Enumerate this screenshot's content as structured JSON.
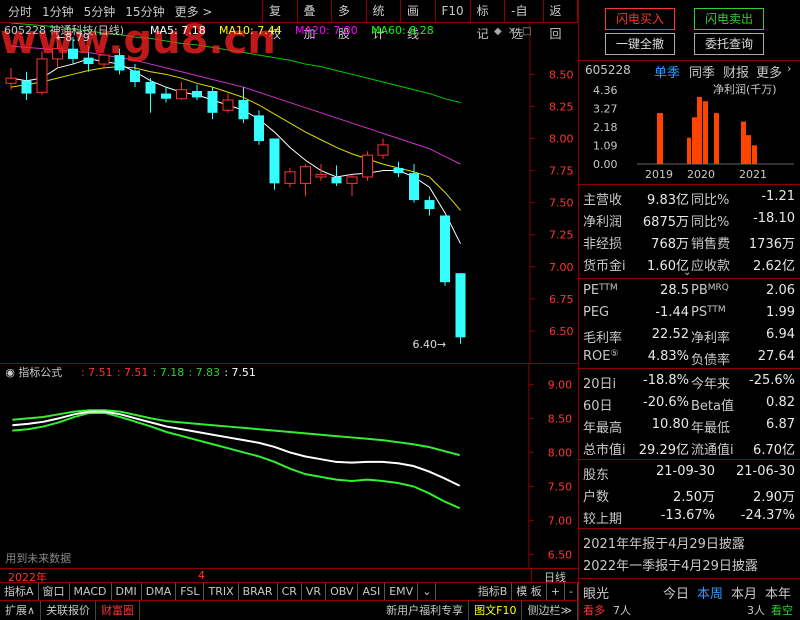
{
  "toolbar": {
    "periods": [
      "分时",
      "1分钟",
      "5分钟",
      "15分钟",
      "更多 >"
    ],
    "actions": [
      "复权",
      "叠加",
      "多股",
      "统计",
      "画线",
      "F10",
      "标记",
      "-自选",
      "返回"
    ]
  },
  "main_chart": {
    "stock_title": "605228 神通科技(日线)",
    "ma": [
      {
        "label": "MA5: 7.18",
        "color": "#ffffff"
      },
      {
        "label": "MA10: 7.44",
        "color": "#ffff00"
      },
      {
        "label": "MA20: 7.80",
        "color": "#ff00ff"
      },
      {
        "label": "MA60: 8.28",
        "color": "#00ff00"
      }
    ],
    "high_label": "8.79",
    "low_label": "6.40",
    "y_ticks": [
      "8.50",
      "8.25",
      "8.00",
      "7.75",
      "7.50",
      "7.25",
      "7.00",
      "6.75",
      "6.50"
    ],
    "watermark": "www.gu8.cn",
    "icons": [
      "diamond-icon",
      "close-icon",
      "square-icon"
    ]
  },
  "chart_data": {
    "type": "candlestick",
    "ylim": [
      6.25,
      8.9
    ],
    "candles": [
      {
        "o": 8.43,
        "h": 8.55,
        "l": 8.38,
        "c": 8.47
      },
      {
        "o": 8.45,
        "h": 8.52,
        "l": 8.3,
        "c": 8.35
      },
      {
        "o": 8.36,
        "h": 8.68,
        "l": 8.34,
        "c": 8.62
      },
      {
        "o": 8.62,
        "h": 8.75,
        "l": 8.55,
        "c": 8.7
      },
      {
        "o": 8.7,
        "h": 8.79,
        "l": 8.58,
        "c": 8.62
      },
      {
        "o": 8.63,
        "h": 8.72,
        "l": 8.52,
        "c": 8.58
      },
      {
        "o": 8.58,
        "h": 8.66,
        "l": 8.55,
        "c": 8.65
      },
      {
        "o": 8.65,
        "h": 8.7,
        "l": 8.5,
        "c": 8.53
      },
      {
        "o": 8.53,
        "h": 8.58,
        "l": 8.4,
        "c": 8.44
      },
      {
        "o": 8.44,
        "h": 8.47,
        "l": 8.2,
        "c": 8.35
      },
      {
        "o": 8.35,
        "h": 8.4,
        "l": 8.28,
        "c": 8.31
      },
      {
        "o": 8.31,
        "h": 8.44,
        "l": 8.3,
        "c": 8.38
      },
      {
        "o": 8.37,
        "h": 8.42,
        "l": 8.3,
        "c": 8.32
      },
      {
        "o": 8.37,
        "h": 8.4,
        "l": 8.15,
        "c": 8.2
      },
      {
        "o": 8.22,
        "h": 8.35,
        "l": 8.2,
        "c": 8.3
      },
      {
        "o": 8.3,
        "h": 8.4,
        "l": 8.12,
        "c": 8.15
      },
      {
        "o": 8.18,
        "h": 8.22,
        "l": 7.95,
        "c": 7.98
      },
      {
        "o": 8.0,
        "h": 8.0,
        "l": 7.6,
        "c": 7.65
      },
      {
        "o": 7.65,
        "h": 7.77,
        "l": 7.62,
        "c": 7.74
      },
      {
        "o": 7.65,
        "h": 7.8,
        "l": 7.55,
        "c": 7.78
      },
      {
        "o": 7.7,
        "h": 7.8,
        "l": 7.67,
        "c": 7.72
      },
      {
        "o": 7.7,
        "h": 7.79,
        "l": 7.63,
        "c": 7.65
      },
      {
        "o": 7.65,
        "h": 7.72,
        "l": 7.55,
        "c": 7.7
      },
      {
        "o": 7.7,
        "h": 7.9,
        "l": 7.67,
        "c": 7.87
      },
      {
        "o": 7.87,
        "h": 8.0,
        "l": 7.84,
        "c": 7.95
      },
      {
        "o": 7.77,
        "h": 7.82,
        "l": 7.7,
        "c": 7.73
      },
      {
        "o": 7.73,
        "h": 7.8,
        "l": 7.5,
        "c": 7.52
      },
      {
        "o": 7.52,
        "h": 7.55,
        "l": 7.4,
        "c": 7.45
      },
      {
        "o": 7.4,
        "h": 7.4,
        "l": 6.85,
        "c": 6.88
      },
      {
        "o": 6.95,
        "h": 6.95,
        "l": 6.4,
        "c": 6.45
      }
    ],
    "ma5": [
      8.47,
      8.45,
      8.47,
      8.55,
      8.58,
      8.62,
      8.6,
      8.58,
      8.52,
      8.45,
      8.4,
      8.36,
      8.34,
      8.3,
      8.26,
      8.22,
      8.15,
      8.05,
      7.93,
      7.83,
      7.75,
      7.7,
      7.72,
      7.73,
      7.75,
      7.75,
      7.7,
      7.62,
      7.42,
      7.18
    ],
    "ma10": [
      8.4,
      8.42,
      8.44,
      8.47,
      8.5,
      8.53,
      8.55,
      8.56,
      8.55,
      8.52,
      8.5,
      8.47,
      8.43,
      8.4,
      8.36,
      8.32,
      8.26,
      8.19,
      8.12,
      8.05,
      7.99,
      7.93,
      7.88,
      7.84,
      7.8,
      7.77,
      7.74,
      7.7,
      7.58,
      7.44
    ],
    "ma20": [
      8.72,
      8.71,
      8.7,
      8.69,
      8.68,
      8.67,
      8.65,
      8.63,
      8.61,
      8.58,
      8.55,
      8.52,
      8.49,
      8.46,
      8.43,
      8.4,
      8.36,
      8.32,
      8.28,
      8.24,
      8.2,
      8.16,
      8.12,
      8.08,
      8.04,
      8.0,
      7.96,
      7.92,
      7.86,
      7.8
    ],
    "ma60": [
      8.9,
      8.89,
      8.88,
      8.87,
      8.85,
      8.84,
      8.82,
      8.81,
      8.79,
      8.78,
      8.76,
      8.74,
      8.73,
      8.71,
      8.69,
      8.67,
      8.65,
      8.63,
      8.61,
      8.58,
      8.56,
      8.53,
      8.5,
      8.47,
      8.44,
      8.41,
      8.38,
      8.35,
      8.31,
      8.28
    ]
  },
  "indicator": {
    "label": "指标公式",
    "values": [
      {
        "text": ": 7.51",
        "color": "#ff3333"
      },
      {
        "text": ": 7.51",
        "color": "#ff3333"
      },
      {
        "text": ": 7.18",
        "color": "#33cc33"
      },
      {
        "text": ": 7.83",
        "color": "#33cc33"
      },
      {
        "text": ": 7.51",
        "color": "#ffffff"
      }
    ],
    "y_ticks": [
      "9.00",
      "8.50",
      "8.00",
      "7.50",
      "7.00",
      "6.50"
    ],
    "footnote": "用到未来数据",
    "ylim": [
      6.3,
      9.3
    ],
    "upper": [
      8.48,
      8.5,
      8.52,
      8.56,
      8.6,
      8.62,
      8.62,
      8.6,
      8.55,
      8.5,
      8.46,
      8.44,
      8.42,
      8.4,
      8.38,
      8.36,
      8.34,
      8.32,
      8.3,
      8.28,
      8.26,
      8.24,
      8.22,
      8.2,
      8.18,
      8.15,
      8.12,
      8.08,
      8.02,
      7.96
    ],
    "mid": [
      8.4,
      8.42,
      8.45,
      8.5,
      8.56,
      8.6,
      8.6,
      8.56,
      8.5,
      8.44,
      8.38,
      8.34,
      8.3,
      8.26,
      8.22,
      8.18,
      8.14,
      8.08,
      8.0,
      7.94,
      7.9,
      7.86,
      7.85,
      7.86,
      7.86,
      7.84,
      7.8,
      7.72,
      7.62,
      7.51
    ],
    "lower": [
      8.32,
      8.34,
      8.38,
      8.44,
      8.52,
      8.58,
      8.58,
      8.52,
      8.45,
      8.38,
      8.3,
      8.24,
      8.18,
      8.12,
      8.06,
      8.0,
      7.94,
      7.86,
      7.76,
      7.68,
      7.64,
      7.6,
      7.58,
      7.6,
      7.58,
      7.55,
      7.5,
      7.4,
      7.28,
      7.18
    ]
  },
  "time_axis": {
    "year": "2022年",
    "month": "4",
    "period": "日线"
  },
  "indicator_tabs": [
    "指标A",
    "窗口",
    "MACD",
    "DMI",
    "DMA",
    "FSL",
    "TRIX",
    "BRAR",
    "CR",
    "VR",
    "OBV",
    "ASI",
    "EMV",
    "⌄",
    "指标B",
    "模 板",
    "+",
    "-"
  ],
  "bottom_bar": {
    "items": [
      "扩展∧",
      "关联报价",
      "财富圈"
    ],
    "promo": "新用户福利专享",
    "f10": "图文F10",
    "sidebar": "侧边栏≫"
  },
  "trade": {
    "buy": "闪电买入",
    "sell": "闪电卖出",
    "all": "一键全撤",
    "query": "委托查询"
  },
  "fin": {
    "code": "605228",
    "tabs": [
      "单季",
      "同季",
      "财报",
      "更多"
    ],
    "more_arrow": "›",
    "bar_title": "净利润(千万)",
    "bar_y": [
      "4.36",
      "3.27",
      "2.18",
      "1.09",
      "0.00"
    ],
    "bar_years": [
      "2019",
      "2020",
      "2021"
    ],
    "bar_values": [
      3.0,
      1.55,
      2.75,
      3.95,
      3.7,
      3.0,
      2.5,
      1.7,
      1.1
    ]
  },
  "rows1": [
    {
      "l1": "主营收",
      "v1": "9.83亿",
      "l2": "同比%",
      "v2": "-1.21"
    },
    {
      "l1": "净利润",
      "v1": "6875万",
      "l2": "同比%",
      "v2": "-18.10"
    },
    {
      "l1": "非经损",
      "v1": "768万",
      "l2": "销售费",
      "v2": "1736万"
    },
    {
      "l1": "货币金i",
      "v1": "1.60亿",
      "l2": "应收款",
      "v2": "2.62亿"
    }
  ],
  "rows2": [
    {
      "l1": "PE",
      "s1": "TTM",
      "v1": "28.5",
      "l2": "PB",
      "s2": "MRQ",
      "v2": "2.06"
    },
    {
      "l1": "PEG",
      "s1": "",
      "v1": "-1.44",
      "l2": "PS",
      "s2": "TTM",
      "v2": "1.99"
    },
    {
      "l1": "毛利率",
      "s1": "",
      "v1": "22.52",
      "l2": "净利率",
      "s2": "",
      "v2": "6.94"
    },
    {
      "l1": "ROE",
      "s1": "⑤",
      "v1": "4.83%",
      "l2": "负债率",
      "s2": "",
      "v2": "27.64"
    }
  ],
  "rows3": [
    {
      "l1": "20日i",
      "v1": "-18.8%",
      "l2": "今年来",
      "v2": "-25.6%"
    },
    {
      "l1": "60日",
      "v1": "-20.6%",
      "l2": "Beta值",
      "v2": "0.82"
    },
    {
      "l1": "年最高",
      "v1": "10.80",
      "l2": "年最低",
      "v2": "6.87"
    },
    {
      "l1": "总市值i",
      "v1": "29.29亿",
      "l2": "流通值i",
      "v2": "6.70亿"
    }
  ],
  "holders": {
    "label": "股东",
    "d1": "21-09-30",
    "d2": "21-06-30",
    "rows": [
      {
        "l": "户数",
        "v1": "2.50万",
        "v2": "2.90万"
      },
      {
        "l": "较上期",
        "v1": "-13.67%",
        "v2": "-24.37%"
      }
    ]
  },
  "notices": [
    "2021年年报于4月29日披露",
    "2022年一季报于4月29日披露"
  ],
  "eye": {
    "label": "眼光",
    "tabs": [
      "今日",
      "本周",
      "本月",
      "本年"
    ],
    "bull_label": "看多",
    "bull_count": "7人",
    "bear_count": "3人",
    "bear_label": "看空"
  }
}
